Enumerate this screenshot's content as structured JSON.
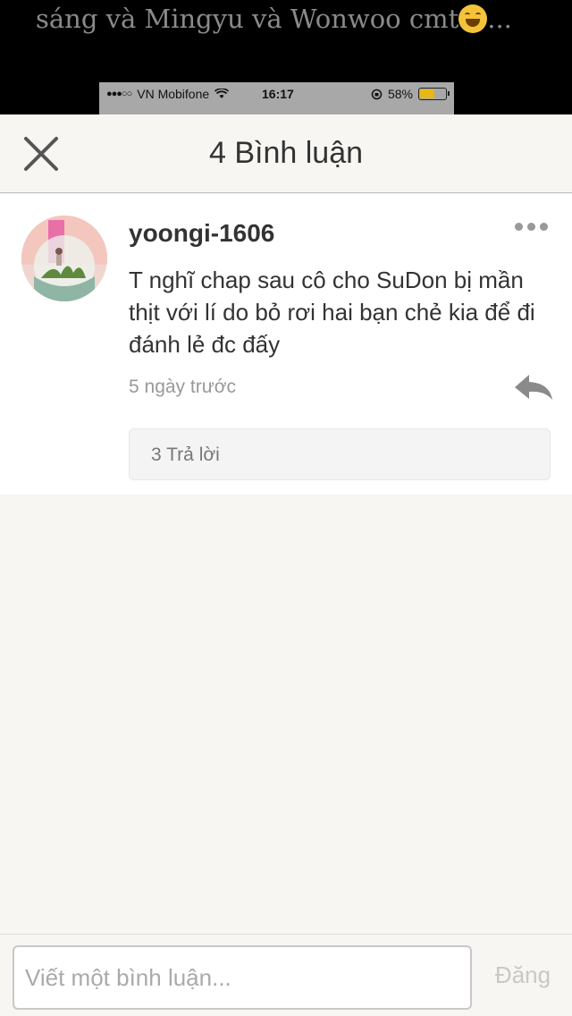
{
  "background": {
    "story_text": "sáng và Mingyu và Wonwoo cmt",
    "story_text_end": "...",
    "emoji": "tears-of-joy-emoji"
  },
  "status_bar": {
    "signal": "●●●○○",
    "carrier": "VN Mobifone",
    "time": "16:17",
    "battery_percent": "58%",
    "battery_level": 0.58
  },
  "header": {
    "title": "4 Bình luận"
  },
  "comment": {
    "username": "yoongi-1606",
    "text": "T nghĩ chap sau cô cho SuDon bị mần thịt với lí do bỏ rơi hai bạn chẻ kia để đi đánh lẻ đc đấy",
    "time": "5 ngày trước",
    "replies_label": "3 Trả lời"
  },
  "composer": {
    "placeholder": "Viết một bình luận...",
    "value": "",
    "post_label": "Đăng"
  },
  "colors": {
    "accent_muted": "#c8c8c8",
    "text_primary": "#333333",
    "text_secondary": "#999999",
    "background": "#f7f6f2"
  }
}
